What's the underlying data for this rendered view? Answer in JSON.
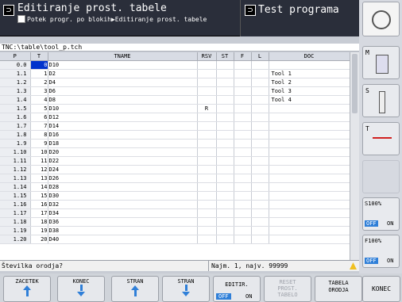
{
  "header": {
    "mode_title": "Editiranje prost. tabele",
    "breadcrumb": "Potek progr. po blokih▶Editiranje prost. tabele",
    "test_title": "Test programa"
  },
  "path": "TNC:\\table\\tool_p.tch",
  "columns": [
    "P",
    "T",
    "TNAME",
    "RSV",
    "ST",
    "F",
    "L",
    "DOC"
  ],
  "rows": [
    {
      "p": "0.0",
      "t": "0",
      "name": "D10",
      "rsv": "",
      "doc": ""
    },
    {
      "p": "1.1",
      "t": "1",
      "name": "D2",
      "rsv": "",
      "doc": "Tool 1"
    },
    {
      "p": "1.2",
      "t": "2",
      "name": "D4",
      "rsv": "",
      "doc": "Tool 2"
    },
    {
      "p": "1.3",
      "t": "3",
      "name": "D6",
      "rsv": "",
      "doc": "Tool 3"
    },
    {
      "p": "1.4",
      "t": "4",
      "name": "D8",
      "rsv": "",
      "doc": "Tool 4"
    },
    {
      "p": "1.5",
      "t": "5",
      "name": "D10",
      "rsv": "R",
      "doc": ""
    },
    {
      "p": "1.6",
      "t": "6",
      "name": "D12",
      "rsv": "",
      "doc": ""
    },
    {
      "p": "1.7",
      "t": "7",
      "name": "D14",
      "rsv": "",
      "doc": ""
    },
    {
      "p": "1.8",
      "t": "8",
      "name": "D16",
      "rsv": "",
      "doc": ""
    },
    {
      "p": "1.9",
      "t": "9",
      "name": "D18",
      "rsv": "",
      "doc": ""
    },
    {
      "p": "1.10",
      "t": "10",
      "name": "D20",
      "rsv": "",
      "doc": ""
    },
    {
      "p": "1.11",
      "t": "11",
      "name": "D22",
      "rsv": "",
      "doc": ""
    },
    {
      "p": "1.12",
      "t": "12",
      "name": "D24",
      "rsv": "",
      "doc": ""
    },
    {
      "p": "1.13",
      "t": "13",
      "name": "D26",
      "rsv": "",
      "doc": ""
    },
    {
      "p": "1.14",
      "t": "14",
      "name": "D28",
      "rsv": "",
      "doc": ""
    },
    {
      "p": "1.15",
      "t": "15",
      "name": "D30",
      "rsv": "",
      "doc": ""
    },
    {
      "p": "1.16",
      "t": "16",
      "name": "D32",
      "rsv": "",
      "doc": ""
    },
    {
      "p": "1.17",
      "t": "17",
      "name": "D34",
      "rsv": "",
      "doc": ""
    },
    {
      "p": "1.18",
      "t": "18",
      "name": "D36",
      "rsv": "",
      "doc": ""
    },
    {
      "p": "1.19",
      "t": "19",
      "name": "D38",
      "rsv": "",
      "doc": ""
    },
    {
      "p": "1.20",
      "t": "20",
      "name": "D40",
      "rsv": "",
      "doc": ""
    }
  ],
  "status": {
    "prompt": "Številka orodja?",
    "range": "Najm. 1, najv. 99999"
  },
  "softkeys": {
    "start": "ZACETEK",
    "end": "KONEC",
    "page": "STRAN",
    "page2": "STRAN",
    "edit": "EDITIR.",
    "edit_off": "OFF",
    "edit_on": "ON",
    "reset": "RESET PROST. TABELO",
    "tool_table": "TABELA ORODJA",
    "exit": "KONEC"
  },
  "vertical": {
    "m": "M",
    "s": "S",
    "t": "T",
    "s_override": "S100%",
    "f_override": "F100%",
    "off": "OFF",
    "on": "ON"
  },
  "colors": {
    "selected": "#0033cc",
    "header_bg": "#2a2e3a",
    "arrow": "#2f7fd8"
  }
}
